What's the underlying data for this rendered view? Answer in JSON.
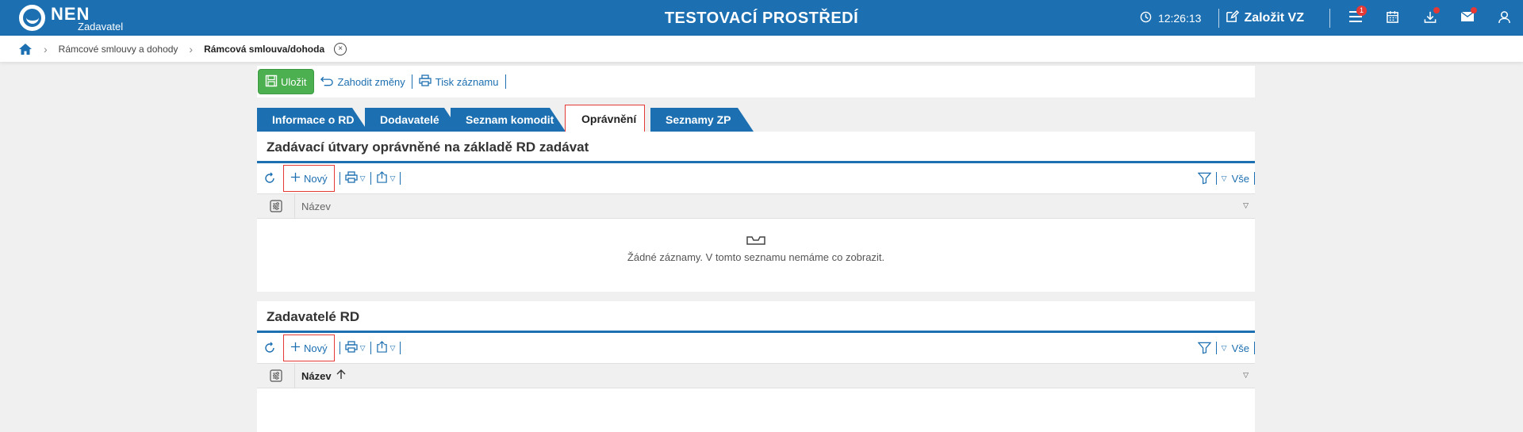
{
  "header": {
    "logo_text": "NEN",
    "logo_sub": "Zadavatel",
    "env_title": "TESTOVACÍ PROSTŘEDÍ",
    "time": "12:26:13",
    "create_label": "Založit VZ",
    "menu_badge": "1",
    "icons": [
      "clock-icon",
      "edit-icon",
      "menu-icon",
      "calendar-icon",
      "download-icon",
      "mail-icon",
      "user-icon"
    ]
  },
  "breadcrumb": {
    "items": [
      "Rámcové smlouvy a dohody",
      "Rámcová smlouva/dohoda"
    ],
    "close_glyph": "×"
  },
  "actions": {
    "save": "Uložit",
    "discard": "Zahodit změny",
    "print": "Tisk záznamu"
  },
  "tabs": [
    "Informace o RD",
    "Dodavatelé",
    "Seznam komodit",
    "Oprávnění",
    "Seznamy ZP"
  ],
  "active_tab": "Oprávnění",
  "sections": [
    {
      "title": "Zadávací útvary oprávněné na základě RD zadávat",
      "new_label": "Nový",
      "filter_all": "Vše",
      "column": "Název",
      "empty_text": "Žádné záznamy. V tomto seznamu nemáme co zobrazit."
    },
    {
      "title": "Zadavatelé RD",
      "new_label": "Nový",
      "filter_all": "Vše",
      "column": "Název",
      "sort": "ascending"
    }
  ],
  "colors": {
    "primary": "#1c6fb0",
    "save": "#4caf50",
    "highlight": "#e53935",
    "background": "#f0f0f0"
  }
}
